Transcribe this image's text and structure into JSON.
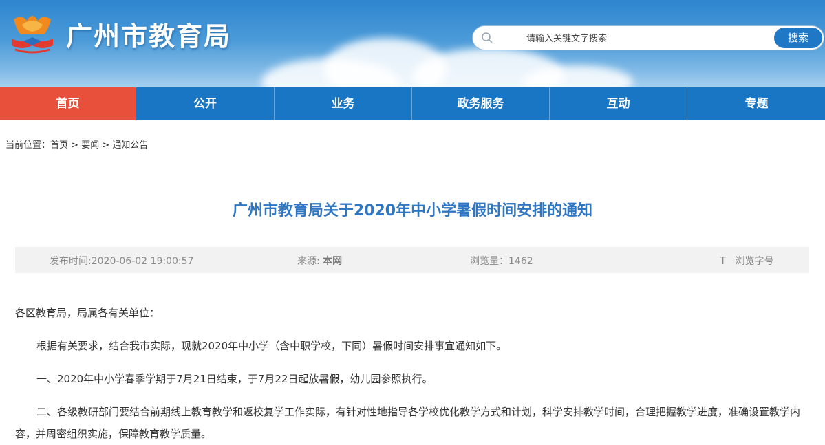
{
  "header": {
    "site_title": "广州市教育局",
    "search_placeholder": "请输入关键文字搜索",
    "search_button": "搜索"
  },
  "nav": {
    "items": [
      {
        "label": "首页",
        "active": true
      },
      {
        "label": "公开",
        "active": false
      },
      {
        "label": "业务",
        "active": false
      },
      {
        "label": "政务服务",
        "active": false
      },
      {
        "label": "互动",
        "active": false
      },
      {
        "label": "专题",
        "active": false
      }
    ]
  },
  "breadcrumb": {
    "prefix": "当前位置：",
    "items": [
      "首页",
      "要闻",
      "通知公告"
    ],
    "separator": " > "
  },
  "article": {
    "title": "广州市教育局关于2020年中小学暑假时间安排的通知",
    "meta": {
      "publish_label": "发布时间:",
      "publish_time": "2020-06-02 19:00:57",
      "source_label": "来源:",
      "source": "本网",
      "views_label": "浏览量：",
      "views": "1462",
      "font_icon": "T",
      "font_label": "浏览字号"
    },
    "paragraphs": [
      "各区教育局，局属各有关单位：",
      "根据有关要求，结合我市实际，现就2020年中小学（含中职学校，下同）暑假时间安排事宜通知如下。",
      "一、2020年中小学春季学期于7月21日结束，于7月22日起放暑假，幼儿园参照执行。",
      "二、各级教研部门要结合前期线上教育教学和返校复学工作实际，有针对性地指导各学校优化教学方式和计划，科学安排教学时间，合理把握教学进度，准确设置教学内容，并周密组织实施，保障教育教学质量。"
    ]
  },
  "colors": {
    "nav_bg": "#1976c5",
    "nav_active": "#e8503c",
    "title_blue": "#2f77c3",
    "search_button": "#1f78c6"
  }
}
